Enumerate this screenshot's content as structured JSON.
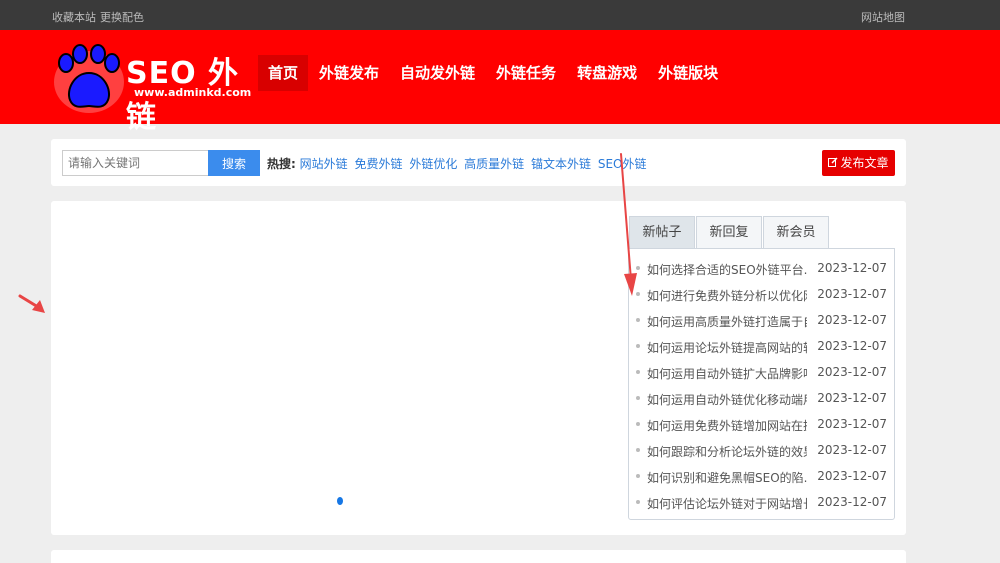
{
  "topbar": {
    "bookmark": "收藏本站",
    "theme": "更换配色",
    "sitemap": "网站地图"
  },
  "logo": {
    "text": "SEO 外链",
    "url": "www.adminkd.com"
  },
  "nav": [
    {
      "label": "首页",
      "active": true
    },
    {
      "label": "外链发布"
    },
    {
      "label": "自动发外链"
    },
    {
      "label": "外链任务"
    },
    {
      "label": "转盘游戏"
    },
    {
      "label": "外链版块"
    }
  ],
  "search": {
    "placeholder": "请输入关键词",
    "button": "搜索",
    "hot_label": "热搜:",
    "hot_tags": [
      "网站外链",
      "免费外链",
      "外链优化",
      "高质量外链",
      "锚文本外链",
      "SEO外链"
    ],
    "post_button": "发布文章"
  },
  "tabs": [
    {
      "label": "新帖子",
      "active": true
    },
    {
      "label": "新回复"
    },
    {
      "label": "新会员"
    }
  ],
  "posts": [
    {
      "title": "如何选择合适的SEO外链平台，提升网站排名",
      "date": "2023-12-07"
    },
    {
      "title": "如何进行免费外链分析以优化网站",
      "date": "2023-12-07"
    },
    {
      "title": "如何运用高质量外链打造属于自己的品牌",
      "date": "2023-12-07"
    },
    {
      "title": "如何运用论坛外链提高网站的转化率",
      "date": "2023-12-07"
    },
    {
      "title": "如何运用自动外链扩大品牌影响力",
      "date": "2023-12-07"
    },
    {
      "title": "如何运用自动外链优化移动端用户体验",
      "date": "2023-12-07"
    },
    {
      "title": "如何运用免费外链增加网站在搜索引擎中的曝光",
      "date": "2023-12-07"
    },
    {
      "title": "如何跟踪和分析论坛外链的效果",
      "date": "2023-12-07"
    },
    {
      "title": "如何识别和避免黑帽SEO的陷阱",
      "date": "2023-12-07"
    },
    {
      "title": "如何评估论坛外链对于网站增长的贡献",
      "date": "2023-12-07"
    }
  ],
  "colors": {
    "header": "#ff0000",
    "nav_active": "#d80000",
    "search_button": "#3b8ced",
    "post_button": "#e60000",
    "link": "#2a7ad8"
  }
}
